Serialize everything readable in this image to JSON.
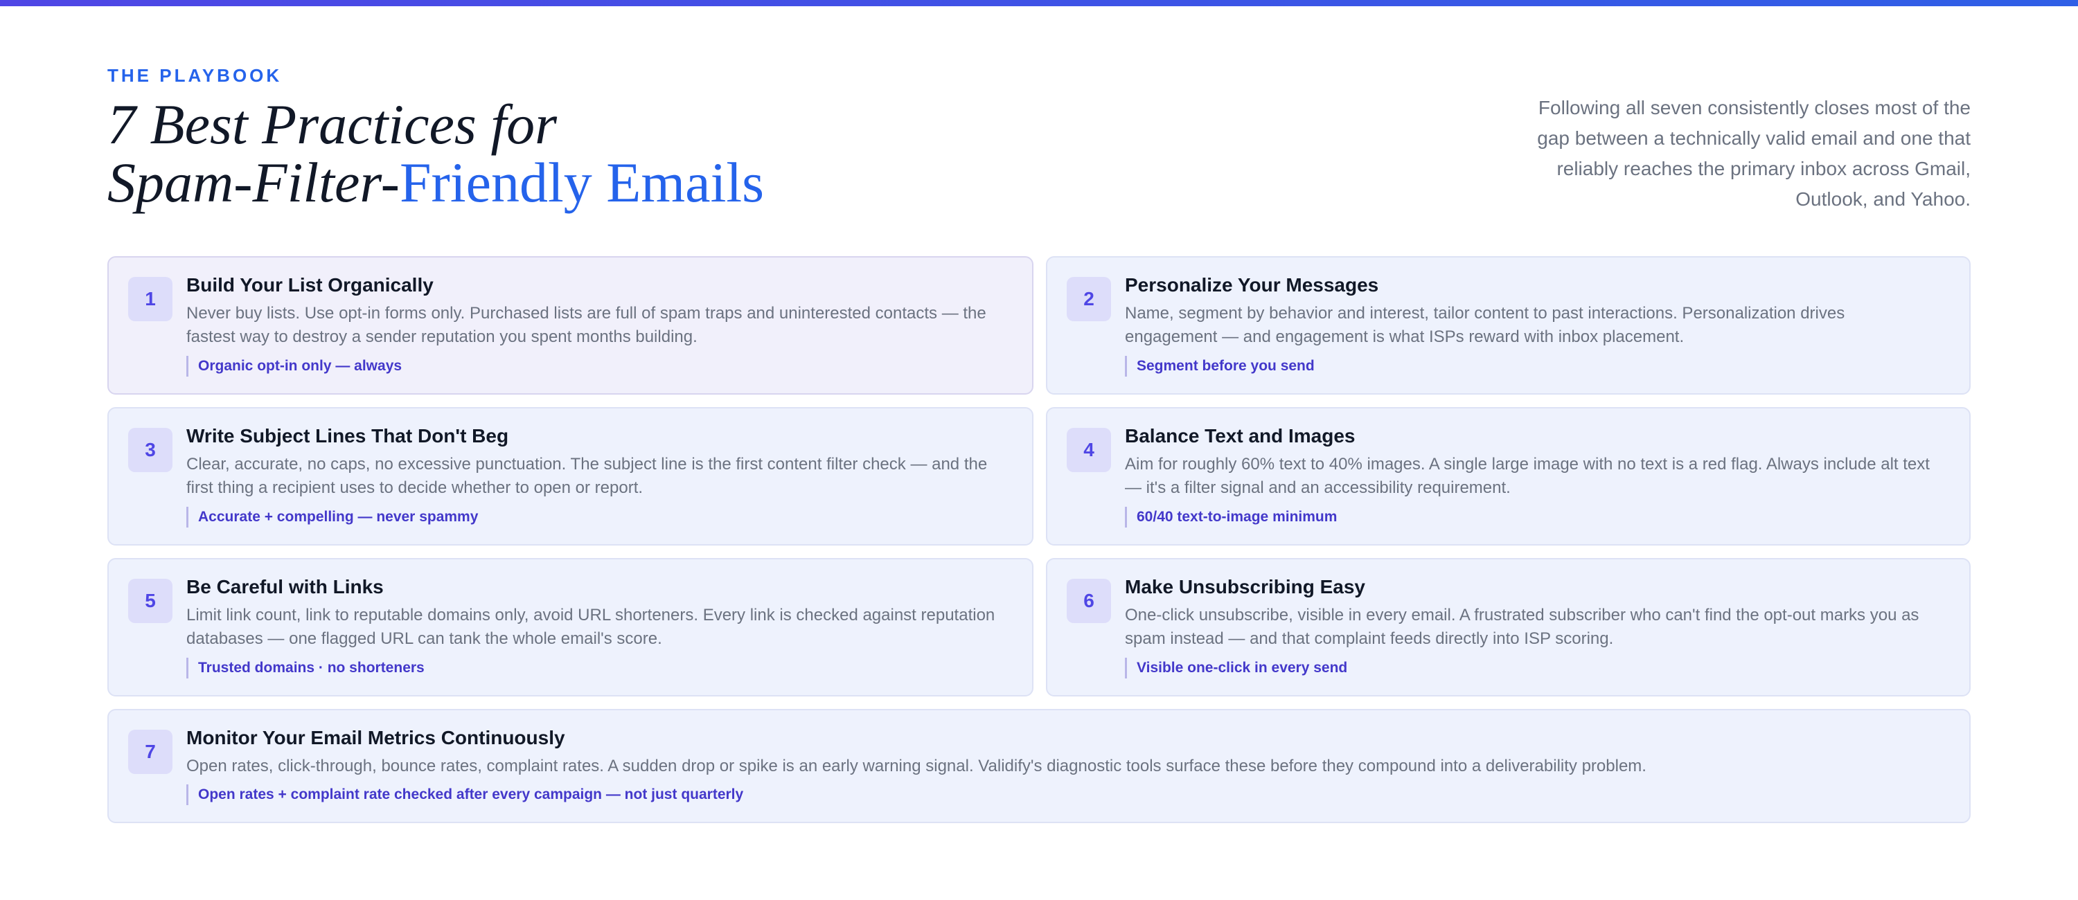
{
  "header": {
    "eyebrow": "THE PLAYBOOK",
    "title_line1": "7 Best Practices for",
    "title_line2_plain": "Spam-Filter-",
    "title_line2_accent": "Friendly Emails",
    "side_note": "Following all seven consistently closes most of the gap between a technically valid email and one that reliably reaches the primary inbox across Gmail, Outlook, and Yahoo."
  },
  "colors": {
    "accent": "#2563eb",
    "indigo": "#4f46e5",
    "card_background": "#eef2fd"
  },
  "practices": [
    {
      "number": "1",
      "title": "Build Your List Organically",
      "body": "Never buy lists. Use opt-in forms only. Purchased lists are full of spam traps and uninterested contacts — the fastest way to destroy a sender reputation you spent months building.",
      "tag": "Organic opt-in only — always"
    },
    {
      "number": "2",
      "title": "Personalize Your Messages",
      "body": "Name, segment by behavior and interest, tailor content to past interactions. Personalization drives engagement — and engagement is what ISPs reward with inbox placement.",
      "tag": "Segment before you send"
    },
    {
      "number": "3",
      "title": "Write Subject Lines That Don't Beg",
      "body": "Clear, accurate, no caps, no excessive punctuation. The subject line is the first content filter check — and the first thing a recipient uses to decide whether to open or report.",
      "tag": "Accurate + compelling — never spammy"
    },
    {
      "number": "4",
      "title": "Balance Text and Images",
      "body": "Aim for roughly 60% text to 40% images. A single large image with no text is a red flag. Always include alt text — it's a filter signal and an accessibility requirement.",
      "tag": "60/40 text-to-image minimum"
    },
    {
      "number": "5",
      "title": "Be Careful with Links",
      "body": "Limit link count, link to reputable domains only, avoid URL shorteners. Every link is checked against reputation databases — one flagged URL can tank the whole email's score.",
      "tag": "Trusted domains · no shorteners"
    },
    {
      "number": "6",
      "title": "Make Unsubscribing Easy",
      "body": "One-click unsubscribe, visible in every email. A frustrated subscriber who can't find the opt-out marks you as spam instead — and that complaint feeds directly into ISP scoring.",
      "tag": "Visible one-click in every send"
    },
    {
      "number": "7",
      "title": "Monitor Your Email Metrics Continuously",
      "body": "Open rates, click-through, bounce rates, complaint rates. A sudden drop or spike is an early warning signal. Validify's diagnostic tools surface these before they compound into a deliverability problem.",
      "tag": "Open rates + complaint rate checked after every campaign — not just quarterly"
    }
  ]
}
